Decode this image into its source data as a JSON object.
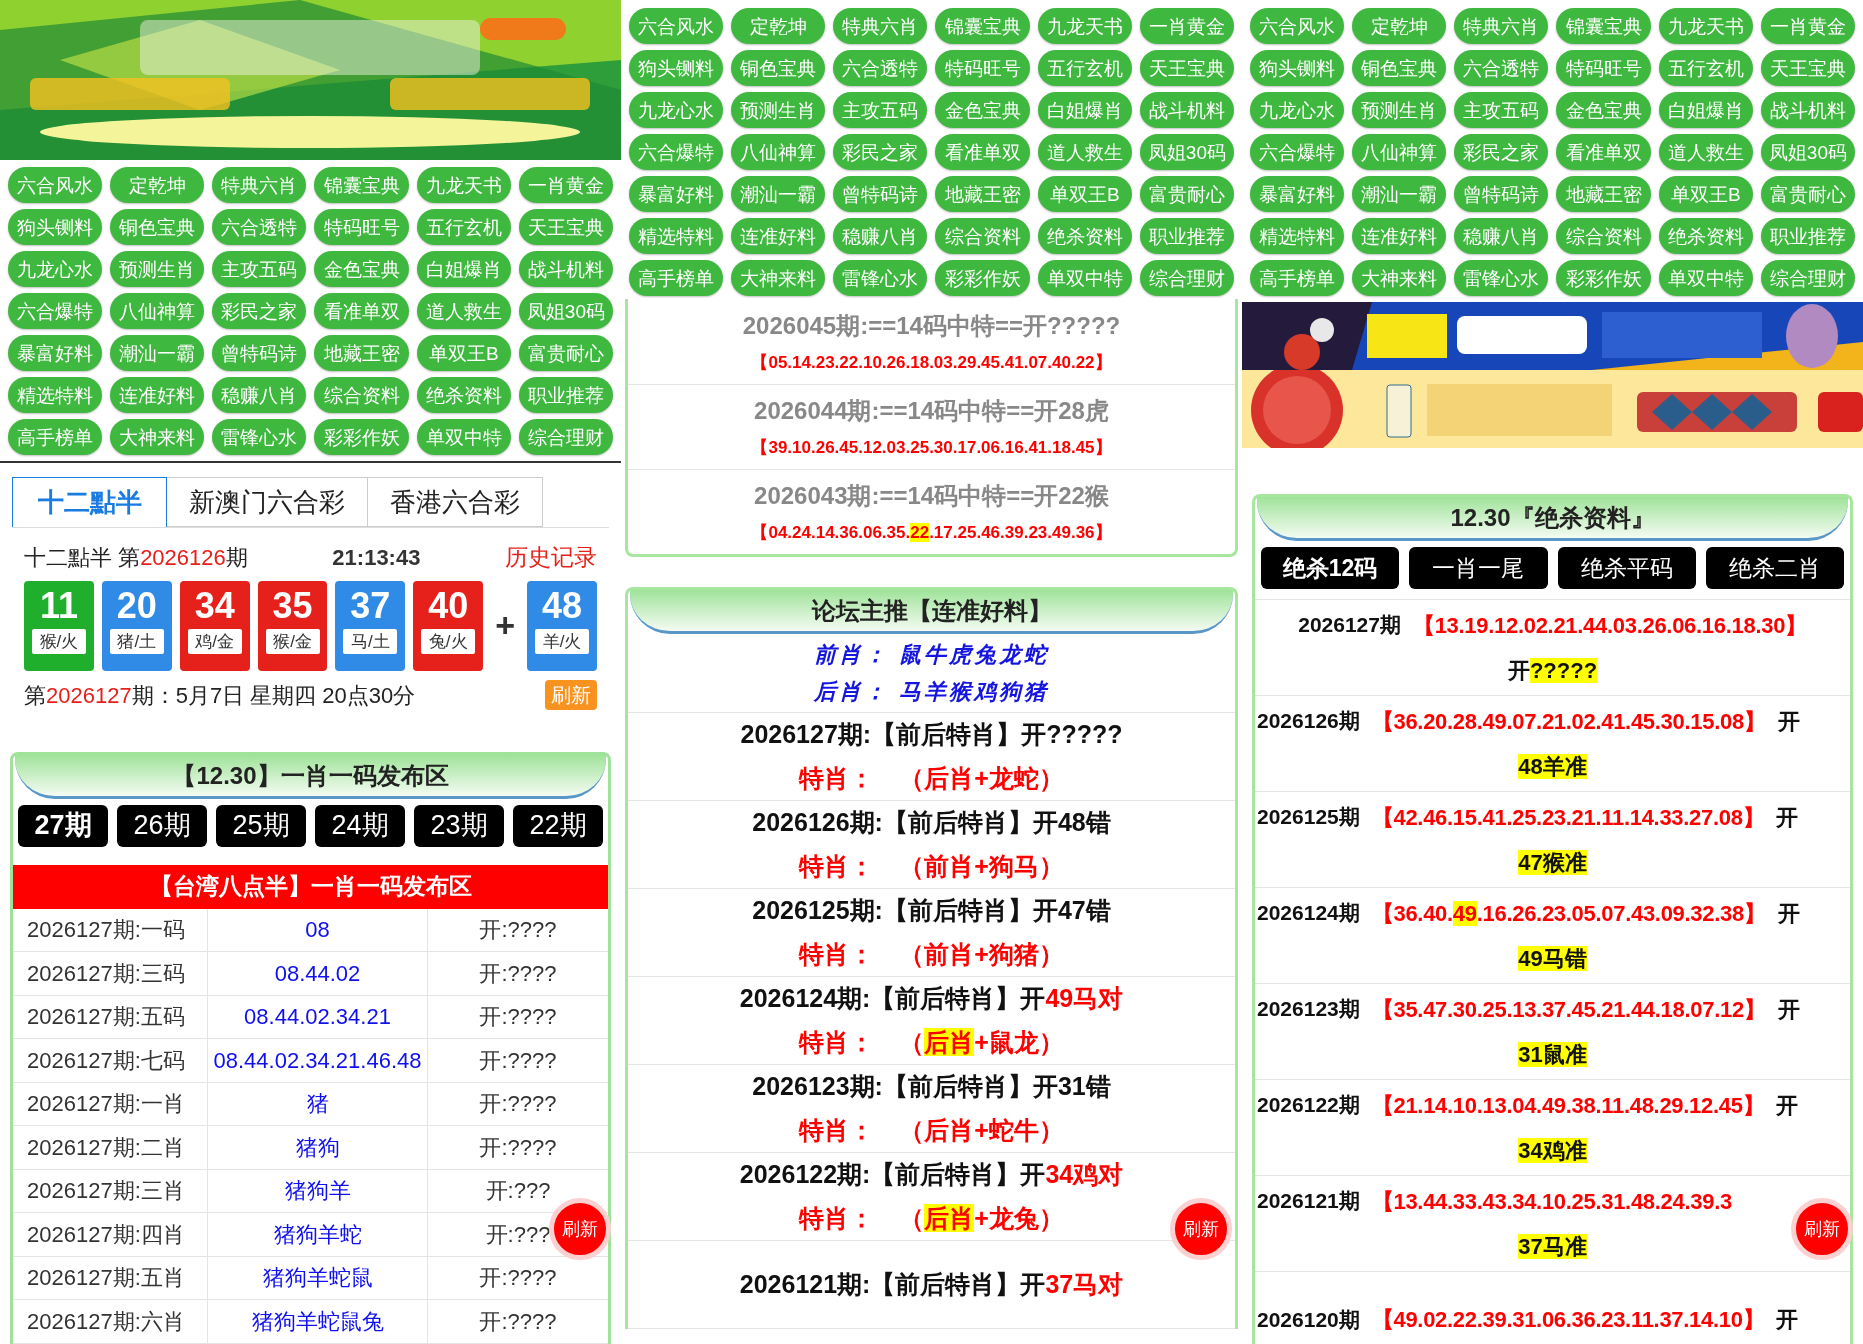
{
  "left": {
    "nav": [
      "六合风水",
      "定乾坤",
      "特典六肖",
      "锦囊宝典",
      "九龙天书",
      "一肖黄金",
      "狗头铡料",
      "铜色宝典",
      "六合透特",
      "特码旺号",
      "五行玄机",
      "天王宝典",
      "九龙心水",
      "预测生肖",
      "主攻五码",
      "金色宝典",
      "白姐爆肖",
      "战斗机料",
      "六合爆特",
      "八仙神算",
      "彩民之家",
      "看准单双",
      "道人救生",
      "凤姐30码",
      "暴富好料",
      "潮汕一霸",
      "曾特码诗",
      "地藏王密",
      "单双王B",
      "富贵耐心",
      "精选特料",
      "连准好料",
      "稳赚八肖",
      "综合资料",
      "绝杀资料",
      "职业推荐",
      "高手榜单",
      "大神来料",
      "雷锋心水",
      "彩彩作妖",
      "单双中特",
      "综合理财"
    ],
    "lottery_tabs": [
      {
        "label": "十二點半",
        "selected": true
      },
      {
        "label": "新澳门六合彩",
        "selected": false
      },
      {
        "label": "香港六合彩",
        "selected": false
      }
    ],
    "draw": {
      "prefix": "十二點半 第",
      "issue": "2026126",
      "suffix": "期",
      "time": "21:13:43",
      "history_link": "历史记录",
      "balls": [
        {
          "number": "11",
          "zodiac": "猴/火",
          "color": "#1faf2c"
        },
        {
          "number": "20",
          "zodiac": "猪/土",
          "color": "#2f8be6"
        },
        {
          "number": "34",
          "zodiac": "鸡/金",
          "color": "#e6211b"
        },
        {
          "number": "35",
          "zodiac": "猴/金",
          "color": "#e6211b"
        },
        {
          "number": "37",
          "zodiac": "马/土",
          "color": "#2f8be6"
        },
        {
          "number": "40",
          "zodiac": "兔/火",
          "color": "#e6211b"
        }
      ],
      "plus": "+",
      "special": {
        "number": "48",
        "zodiac": "羊/火",
        "color": "#2f8be6"
      },
      "next_prefix": "第",
      "next_issue": "2026127",
      "next_suffix": "期：5月7日 星期四 20点30分",
      "refresh": "刷新"
    },
    "card": {
      "title": "【12.30】一肖一码发布区",
      "periods": [
        {
          "label": "27期",
          "selected": true
        },
        {
          "label": "26期",
          "selected": false
        },
        {
          "label": "25期",
          "selected": false
        },
        {
          "label": "24期",
          "selected": false
        },
        {
          "label": "23期",
          "selected": false
        },
        {
          "label": "22期",
          "selected": false
        }
      ],
      "subtitle": "【台湾八点半】一肖一码发布区",
      "rows": [
        {
          "label": "2026127期:一码",
          "value": "08",
          "result": "开:????"
        },
        {
          "label": "2026127期:三码",
          "value": "08.44.02",
          "result": "开:????"
        },
        {
          "label": "2026127期:五码",
          "value": "08.44.02.34.21",
          "result": "开:????"
        },
        {
          "label": "2026127期:七码",
          "value": "08.44.02.34.21.46.48",
          "result": "开:????"
        },
        {
          "label": "2026127期:一肖",
          "value": "猪",
          "result": "开:????"
        },
        {
          "label": "2026127期:二肖",
          "value": "猪狗",
          "result": "开:????"
        },
        {
          "label": "2026127期:三肖",
          "value": "猪狗羊",
          "result": "开:???"
        },
        {
          "label": "2026127期:四肖",
          "value": "猪狗羊蛇",
          "result": "开:???"
        },
        {
          "label": "2026127期:五肖",
          "value": "猪狗羊蛇鼠",
          "result": "开:????"
        },
        {
          "label": "2026127期:六肖",
          "value": "猪狗羊蛇鼠兔",
          "result": "开:????"
        }
      ]
    },
    "float_refresh": "刷新"
  },
  "middle": {
    "nav": [
      "六合风水",
      "定乾坤",
      "特典六肖",
      "锦囊宝典",
      "九龙天书",
      "一肖黄金",
      "狗头铡料",
      "铜色宝典",
      "六合透特",
      "特码旺号",
      "五行玄机",
      "天王宝典",
      "九龙心水",
      "预测生肖",
      "主攻五码",
      "金色宝典",
      "白姐爆肖",
      "战斗机料",
      "六合爆特",
      "八仙神算",
      "彩民之家",
      "看准单双",
      "道人救生",
      "凤姐30码",
      "暴富好料",
      "潮汕一霸",
      "曾特码诗",
      "地藏王密",
      "单双王B",
      "富贵耐心",
      "精选特料",
      "连准好料",
      "稳赚八肖",
      "综合资料",
      "绝杀资料",
      "职业推荐",
      "高手榜单",
      "大神来料",
      "雷锋心水",
      "彩彩作妖",
      "单双中特",
      "综合理财"
    ],
    "codes_card": [
      {
        "title": "2026045期:==14码中特==开?????",
        "codes": [
          {
            "t": "【05.14.23.22.10.26.18.03.29.45.41.07.40.22】",
            "hit": false
          }
        ]
      },
      {
        "title": "2026044期:==14码中特==开28虎",
        "codes": [
          {
            "t": "【39.10.26.45.12.03.25.30.17.06.16.41.18.45】",
            "hit": false
          }
        ]
      },
      {
        "title": "2026043期:==14码中特==开22猴",
        "codes": [
          {
            "t": "【04.24.14.36.06.35.",
            "hit": false
          },
          {
            "t": "22",
            "hit": true
          },
          {
            "t": ".17.25.46.39.23.49.36】",
            "hit": false
          }
        ]
      }
    ],
    "forum": {
      "title": "论坛主推【连准好料】",
      "front_label": "前肖：",
      "front": "鼠牛虎兔龙蛇",
      "back_label": "后肖：",
      "back": "马羊猴鸡狗猪",
      "rows": [
        {
          "issue": "2026127期:【前后特肖】开",
          "result": "?????",
          "hit": false,
          "label": "特肖：",
          "open": "（",
          "group": "后肖",
          "group_hit": false,
          "rest": "+龙蛇）"
        },
        {
          "issue": "2026126期:【前后特肖】开",
          "result": "48错",
          "hit": false,
          "label": "特肖：",
          "open": "（",
          "group": "前肖",
          "group_hit": false,
          "rest": "+狗马）"
        },
        {
          "issue": "2026125期:【前后特肖】开",
          "result": "47错",
          "hit": false,
          "label": "特肖：",
          "open": "（",
          "group": "前肖",
          "group_hit": false,
          "rest": "+狗猪）"
        },
        {
          "issue": "2026124期:【前后特肖】开",
          "result": "49马对",
          "hit": true,
          "label": "特肖：",
          "open": "（",
          "group": "后肖",
          "group_hit": true,
          "rest": "+鼠龙）"
        },
        {
          "issue": "2026123期:【前后特肖】开",
          "result": "31错",
          "hit": false,
          "label": "特肖：",
          "open": "（",
          "group": "后肖",
          "group_hit": false,
          "rest": "+蛇牛）"
        },
        {
          "issue": "2026122期:【前后特肖】开",
          "result": "34鸡对",
          "hit": true,
          "label": "特肖：",
          "open": "（",
          "group": "后肖",
          "group_hit": true,
          "rest": "+龙兔）"
        },
        {
          "issue": "2026121期:【前后特肖】开",
          "result": "37马对",
          "hit": true
        }
      ]
    },
    "float_refresh": "刷新"
  },
  "right": {
    "nav": [
      "六合风水",
      "定乾坤",
      "特典六肖",
      "锦囊宝典",
      "九龙天书",
      "一肖黄金",
      "狗头铡料",
      "铜色宝典",
      "六合透特",
      "特码旺号",
      "五行玄机",
      "天王宝典",
      "九龙心水",
      "预测生肖",
      "主攻五码",
      "金色宝典",
      "白姐爆肖",
      "战斗机料",
      "六合爆特",
      "八仙神算",
      "彩民之家",
      "看准单双",
      "道人救生",
      "凤姐30码",
      "暴富好料",
      "潮汕一霸",
      "曾特码诗",
      "地藏王密",
      "单双王B",
      "富贵耐心",
      "精选特料",
      "连准好料",
      "稳赚八肖",
      "综合资料",
      "绝杀资料",
      "职业推荐",
      "高手榜单",
      "大神来料",
      "雷锋心水",
      "彩彩作妖",
      "单双中特",
      "综合理财"
    ],
    "card": {
      "title": "12.30『绝杀资料』",
      "tabs": [
        {
          "label": "绝杀12码",
          "selected": true
        },
        {
          "label": "一肖一尾",
          "selected": false
        },
        {
          "label": "绝杀平码",
          "selected": false
        },
        {
          "label": "绝杀二肖",
          "selected": false
        }
      ],
      "rows": [
        {
          "kind": "current",
          "issue": "2026127期",
          "codes": [
            {
              "t": "【13.19.12.02.21.44.03.26.06.16.18.30】",
              "hit": false
            }
          ],
          "result": [
            {
              "t": "开",
              "hl": false
            },
            {
              "t": "?????",
              "hl": true
            }
          ]
        },
        {
          "kind": "past",
          "issue": "2026126期",
          "codes": [
            {
              "t": "【36.20.28.49.07.21.02.41.45.30.15.08】",
              "hit": false
            }
          ],
          "open": "开",
          "result": [
            {
              "t": "48羊准",
              "hl": true
            }
          ]
        },
        {
          "kind": "past",
          "issue": "2026125期",
          "codes": [
            {
              "t": "【42.46.15.41.25.23.21.11.14.33.27.08】",
              "hit": false
            }
          ],
          "open": "开",
          "result": [
            {
              "t": "47猴准",
              "hl": true
            }
          ]
        },
        {
          "kind": "past",
          "issue": "2026124期",
          "codes": [
            {
              "t": "【36.40.",
              "hit": false
            },
            {
              "t": "49",
              "hit": true
            },
            {
              "t": ".16.26.23.05.07.43.09.32.38】",
              "hit": false
            }
          ],
          "open": "开",
          "result": [
            {
              "t": "49马错",
              "hl": true
            }
          ]
        },
        {
          "kind": "past",
          "issue": "2026123期",
          "codes": [
            {
              "t": "【35.47.30.25.13.37.45.21.44.18.07.12】",
              "hit": false
            }
          ],
          "open": "开",
          "result": [
            {
              "t": "31鼠准",
              "hl": true
            }
          ]
        },
        {
          "kind": "past",
          "issue": "2026122期",
          "codes": [
            {
              "t": "【21.14.10.13.04.49.38.11.48.29.12.45】",
              "hit": false
            }
          ],
          "open": "开",
          "result": [
            {
              "t": "34鸡准",
              "hl": true
            }
          ]
        },
        {
          "kind": "past",
          "issue": "2026121期",
          "codes": [
            {
              "t": "【13.44.33.43.34.10.25.31.48.24.39.3",
              "hit": false
            }
          ],
          "result": [
            {
              "t": "37马准",
              "hl": true
            }
          ]
        },
        {
          "kind": "past",
          "issue": "2026120期",
          "codes": [
            {
              "t": "【49.02.22.39.31.06.36.23.11.37.14.10】",
              "hit": false
            }
          ],
          "open": "开"
        }
      ]
    },
    "float_refresh": "刷新"
  }
}
